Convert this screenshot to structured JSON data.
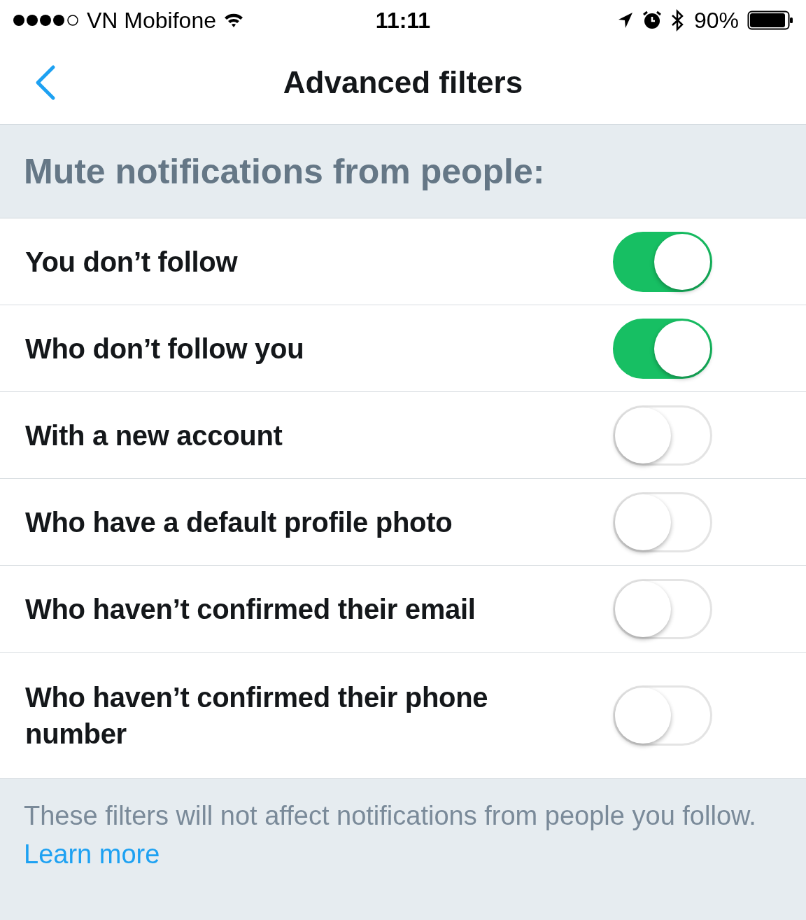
{
  "status_bar": {
    "carrier": "VN Mobifone",
    "time": "11:11",
    "battery": "90%"
  },
  "nav": {
    "title": "Advanced filters"
  },
  "section": {
    "title": "Mute notifications from people:"
  },
  "rows": [
    {
      "label": "You don’t follow",
      "on": true
    },
    {
      "label": "Who don’t follow you",
      "on": true
    },
    {
      "label": "With a new account",
      "on": false
    },
    {
      "label": "Who have a default profile photo",
      "on": false
    },
    {
      "label": "Who haven’t confirmed their email",
      "on": false
    },
    {
      "label": "Who haven’t confirmed their phone number",
      "on": false
    }
  ],
  "footer": {
    "text": "These filters will not affect notifications from people you follow.",
    "link": "Learn more"
  }
}
